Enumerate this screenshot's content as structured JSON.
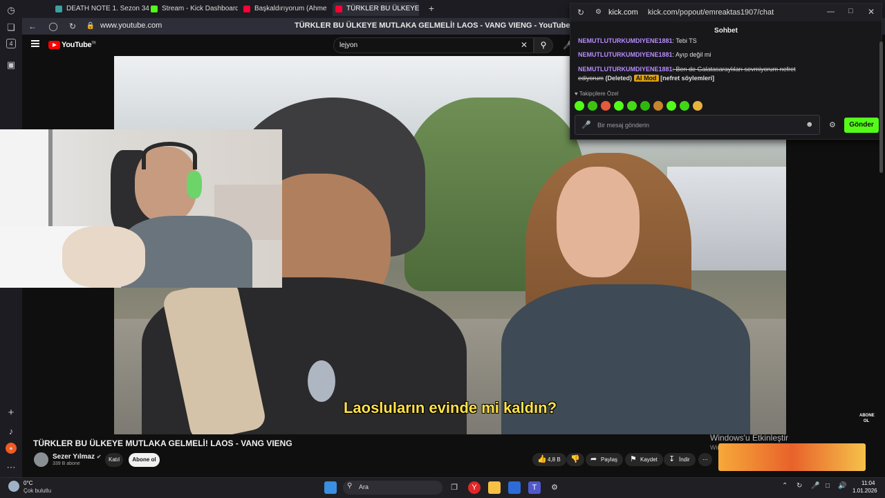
{
  "browser": {
    "rail": {
      "history_icon": "clock-icon",
      "tab_count": "4"
    },
    "tabs": [
      {
        "label": "DEATH NOTE 1. Sezon 34",
        "color": "#3aa0a0"
      },
      {
        "label": "Stream - Kick Dashboard",
        "color": "#53fc18"
      },
      {
        "label": "Başkaldırıyorum (Ahmet K",
        "color": "#ff0033"
      },
      {
        "label": "TÜRKLER BU ÜLKEYE M",
        "color": "#ff0033"
      }
    ],
    "url": "www.youtube.com",
    "page_title": "TÜRKLER BU ÜLKEYE MUTLAKA GELMELİ! LAOS - VANG VIENG - YouTube"
  },
  "youtube": {
    "logo": "YouTube",
    "logo_region": "TR",
    "search_value": "lejyon",
    "video": {
      "caption": "Laosluların evinde mi kaldın?",
      "watermark": "ABONE OL"
    },
    "title": "TÜRKLER BU ÜLKEYE MUTLAKA GELMELİ! LAOS - VANG VIENG",
    "channel": "Sezer Yılmaz",
    "subscribers": "339 B abone",
    "join_label": "Katıl",
    "subscribe_label": "Abone ol",
    "actions": {
      "likes": "4,8 B",
      "share": "Paylaş",
      "save": "Kaydet",
      "download": "İndir"
    },
    "activate_windows": "Windows'u Etkinleştir",
    "activate_windows_sub": "Windows'u"
  },
  "chat": {
    "domain": "kick.com",
    "url": "kick.com/popout/emreaktas1907/chat",
    "title": "Sohbet",
    "messages": [
      {
        "user": "NEMUTLUTURKUMDIYENE1881",
        "text": ": Tebi TS"
      },
      {
        "user": "NEMUTLUTURKUMDIYENE1881",
        "text": ": Ayıp değil mi"
      },
      {
        "user": "NEMUTLUTURKUMDIYENE1881",
        "text": ": Ben de Galatasaraylıları sevmiyorum nefret ediyorum",
        "deleted": "(Deleted)",
        "badge": "AI Mod",
        "reason": "[nefret söylemleri]"
      }
    ],
    "emote_section": "Takipçilere Özel",
    "input_placeholder": "Bir mesaj gönderin",
    "send_label": "Gönder"
  },
  "taskbar": {
    "weather_temp": "0°C",
    "weather_desc": "Çok bulutlu",
    "search_label": "Ara",
    "time": "11:04",
    "date": "1.01.2026"
  },
  "colors": {
    "accent_red": "#ff0000",
    "kick_green": "#53fc18",
    "caption_yellow": "#ffe24a",
    "chat_username": "#b78cff"
  }
}
